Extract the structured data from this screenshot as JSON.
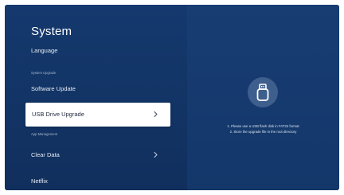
{
  "menu": {
    "title": "System",
    "language": "Language",
    "system_upgrade_section": "System Upgrade",
    "software_update": "Software Update",
    "usb_drive_upgrade": "USB Drive Upgrade",
    "app_management_section": "App Management",
    "clear_data": "Clear Data",
    "netflix": "Netflix"
  },
  "detail": {
    "icon": "usb-flash-drive-icon",
    "line1": "1. Please use a USB flash disk in FAT32 format",
    "line2": "2. Store the upgrade file in the root directory"
  },
  "colors": {
    "background": "#123363",
    "selection": "#ffffff",
    "icon_circle": "#3e5f8d"
  }
}
